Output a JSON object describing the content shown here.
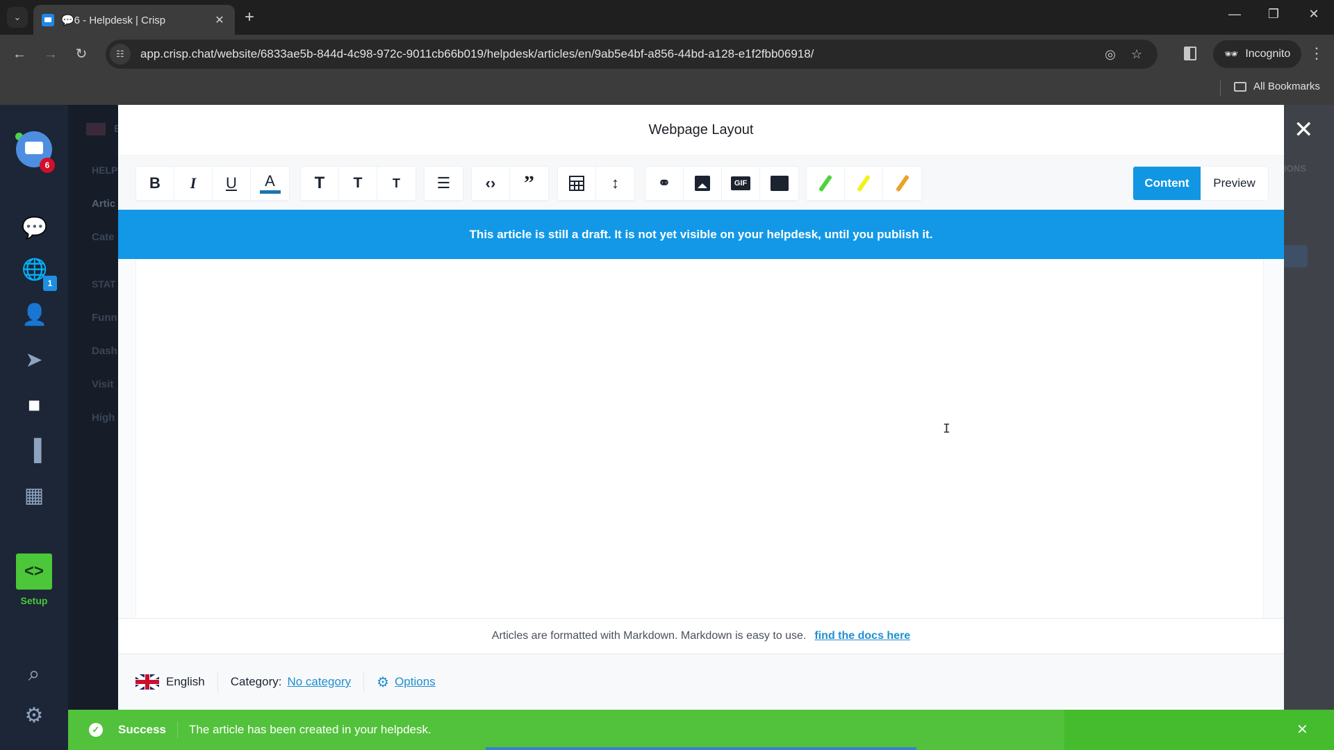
{
  "browser": {
    "tab": {
      "title": "💬6 - Helpdesk | Crisp",
      "close": "✕"
    },
    "new_tab": "+",
    "url": "app.crisp.chat/website/6833ae5b-844d-4c98-972c-9011cb66b019/helpdesk/articles/en/9ab5e4bf-a856-44bd-a128-e1f2fbb06918/",
    "incognito_label": "Incognito",
    "all_bookmarks": "All Bookmarks",
    "icons": {
      "back": "←",
      "forward": "→",
      "reload": "↻",
      "tab_list": "⌄",
      "eye_off": "◎",
      "star": "☆",
      "menu": "⋮",
      "minimize": "—",
      "maximize": "❐",
      "close": "✕"
    }
  },
  "app": {
    "nav": {
      "conversations_badge": "6",
      "visitors_badge": "1",
      "setup_label": "Setup",
      "icons": {
        "inbox": "💬",
        "globe": "🌐",
        "contacts": "👤",
        "campaigns": "➤",
        "helpdesk": "■",
        "analytics": "▐",
        "plugins": "▦",
        "setup": "<>",
        "search": "⌕",
        "settings": "⚙"
      }
    },
    "sub_panel": {
      "items": [
        "E",
        "HELP",
        "Artic",
        "Cate",
        "STAT",
        "Funn",
        "Dash",
        "Visit",
        "High"
      ]
    },
    "bg_right_text": "IONS"
  },
  "modal": {
    "title": "Webpage Layout",
    "close": "✕",
    "toolbar": {
      "groups": [
        [
          {
            "name": "bold",
            "glyph": "B"
          },
          {
            "name": "italic",
            "glyph": "I"
          },
          {
            "name": "underline",
            "glyph": "U"
          },
          {
            "name": "font-color",
            "glyph": "A"
          }
        ],
        [
          {
            "name": "heading-1",
            "glyph": "T"
          },
          {
            "name": "heading-2",
            "glyph": "T"
          },
          {
            "name": "heading-3",
            "glyph": "T"
          }
        ],
        [
          {
            "name": "bullet-list",
            "glyph": "☰"
          }
        ],
        [
          {
            "name": "code",
            "glyph": "‹›"
          },
          {
            "name": "quote",
            "glyph": "”"
          }
        ],
        [
          {
            "name": "table",
            "glyph": ""
          },
          {
            "name": "separator",
            "glyph": "↕"
          }
        ],
        [
          {
            "name": "link",
            "glyph": "⚭"
          },
          {
            "name": "image",
            "glyph": ""
          },
          {
            "name": "gif",
            "glyph": "GIF"
          },
          {
            "name": "video",
            "glyph": ""
          }
        ],
        [
          {
            "name": "highlight-green",
            "color": "#4cd43c"
          },
          {
            "name": "highlight-yellow",
            "color": "#f2f21a"
          },
          {
            "name": "highlight-orange",
            "color": "#eaa22a"
          }
        ]
      ],
      "modes": [
        {
          "label": "Content",
          "active": true
        },
        {
          "label": "Preview",
          "active": false
        }
      ]
    },
    "draft_banner": "This article is still a draft. It is not yet visible on your helpdesk, until you publish it.",
    "editor": {
      "content": "",
      "cursor_glyph": "I"
    },
    "hint": {
      "text": "Articles are formatted with Markdown. Markdown is easy to use.",
      "link": "find the docs here"
    },
    "footer": {
      "language": "English",
      "category_label": "Category:",
      "category_value": "No category",
      "options_label": "Options",
      "gear_icon": "⚙"
    }
  },
  "toast": {
    "status": "success",
    "check_icon": "✓",
    "title": "Success",
    "message": "The article has been created in your helpdesk.",
    "close": "✕",
    "progress": {
      "start_fraction": 0.33,
      "end_fraction": 0.67
    }
  }
}
